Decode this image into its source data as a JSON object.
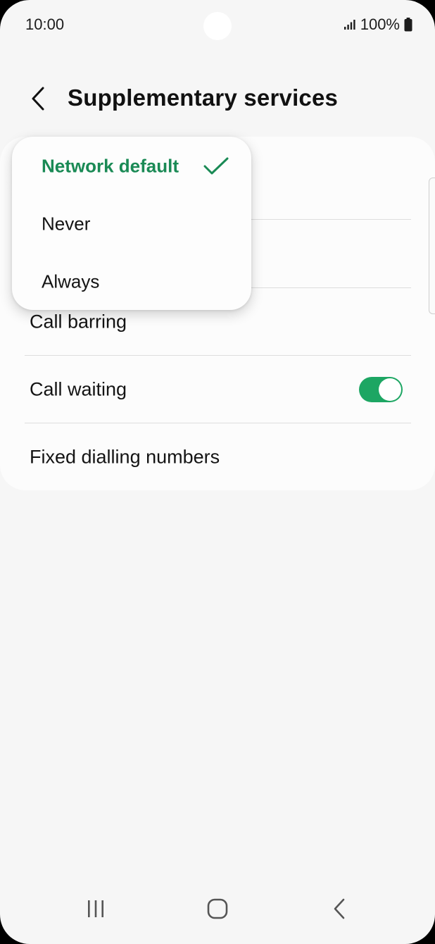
{
  "status_bar": {
    "time": "10:00",
    "battery": "100%"
  },
  "header": {
    "title": "Supplementary services"
  },
  "list": {
    "call_barring": "Call barring",
    "call_waiting": "Call waiting",
    "call_waiting_on": true,
    "fixed_dialling": "Fixed dialling numbers"
  },
  "dropdown": {
    "options": [
      {
        "label": "Network default",
        "selected": true
      },
      {
        "label": "Never",
        "selected": false
      },
      {
        "label": "Always",
        "selected": false
      }
    ]
  },
  "colors": {
    "accent": "#1da663",
    "selected_text": "#1a8a55",
    "background": "#f6f6f6"
  },
  "icons": {
    "back": "chevron-left-icon",
    "check": "check-icon",
    "signal": "signal-icon",
    "battery": "battery-icon",
    "nav_recent": "recent-apps-icon",
    "nav_home": "home-icon",
    "nav_back": "nav-back-icon"
  }
}
